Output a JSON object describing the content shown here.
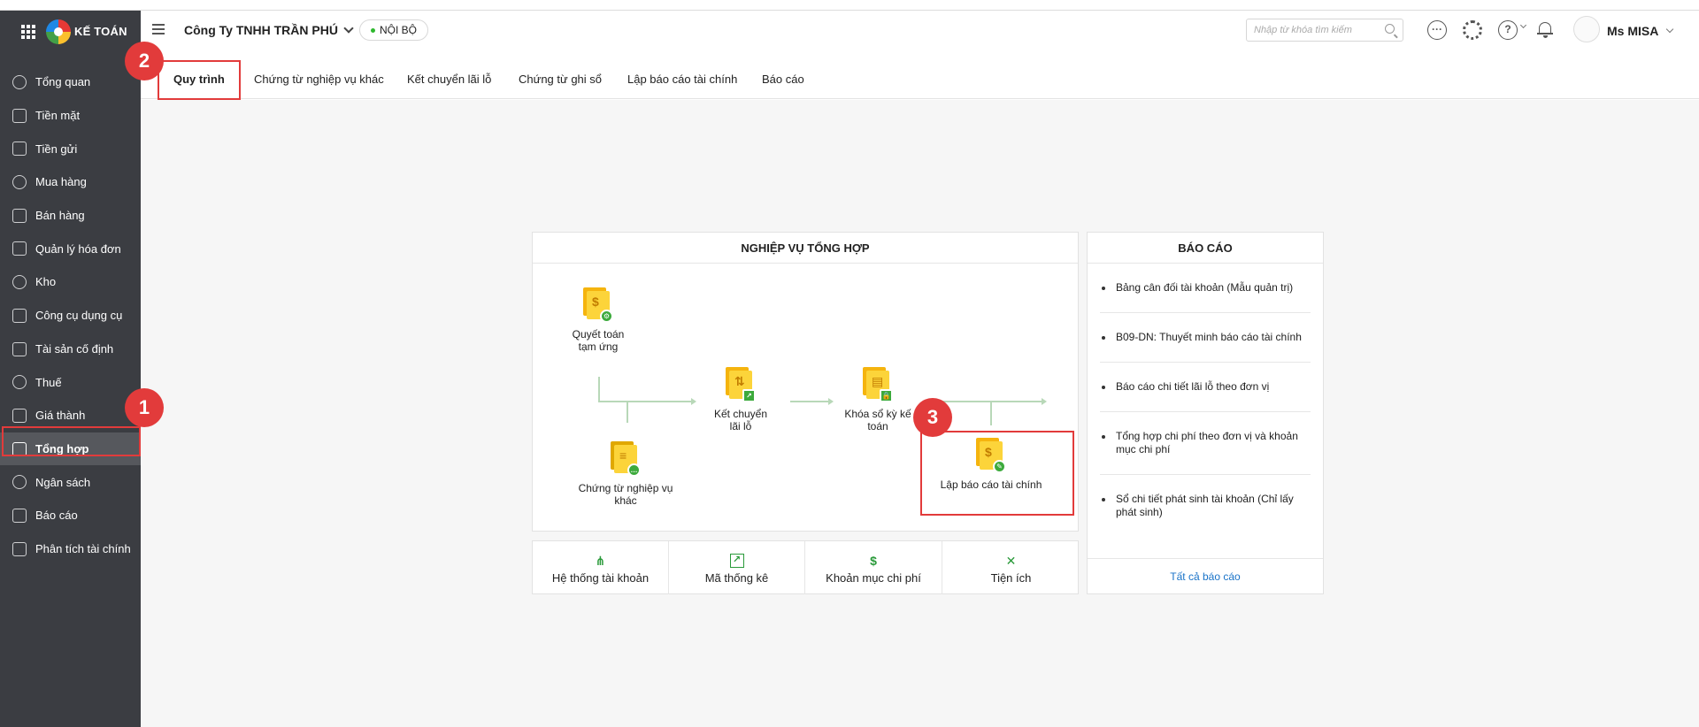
{
  "app": {
    "logo_text": "KẾ TOÁN"
  },
  "header": {
    "company": "Công Ty TNHH TRẦN PHÚ",
    "badge": "NỘI BỘ",
    "search_placeholder": "Nhập từ khóa tìm kiếm",
    "user": "Ms MISA"
  },
  "sidebar": {
    "items": [
      {
        "label": "Tổng quan",
        "icon": "dashboard-icon"
      },
      {
        "label": "Tiền mặt",
        "icon": "cash-icon"
      },
      {
        "label": "Tiền gửi",
        "icon": "bank-icon"
      },
      {
        "label": "Mua hàng",
        "icon": "shopping-bag-icon"
      },
      {
        "label": "Bán hàng",
        "icon": "cart-icon"
      },
      {
        "label": "Quản lý hóa đơn",
        "icon": "invoice-icon"
      },
      {
        "label": "Kho",
        "icon": "warehouse-icon"
      },
      {
        "label": "Công cụ dụng cụ",
        "icon": "tools-icon"
      },
      {
        "label": "Tài sản cố định",
        "icon": "car-icon"
      },
      {
        "label": "Thuế",
        "icon": "tax-icon"
      },
      {
        "label": "Giá thành",
        "icon": "price-tag-icon"
      },
      {
        "label": "Tổng hợp",
        "icon": "summary-icon",
        "active": true
      },
      {
        "label": "Ngân sách",
        "icon": "budget-icon"
      },
      {
        "label": "Báo cáo",
        "icon": "bar-chart-icon"
      },
      {
        "label": "Phân tích tài chính",
        "icon": "line-chart-icon"
      }
    ]
  },
  "tabs": [
    {
      "label": "Quy trình",
      "active": true
    },
    {
      "label": "Chứng từ nghiệp vụ khác"
    },
    {
      "label": "Kết chuyển lãi lỗ"
    },
    {
      "label": "Chứng từ ghi sổ"
    },
    {
      "label": "Lập báo cáo tài chính"
    },
    {
      "label": "Báo cáo"
    }
  ],
  "process": {
    "title": "NGHIỆP VỤ TỔNG HỢP",
    "steps": {
      "advance": "Quyết toán tạm ứng",
      "other": "Chứng từ nghiệp vụ khác",
      "transfer": "Kết chuyển lãi lỗ",
      "lock": "Khóa sổ kỳ kế toán",
      "report": "Lập báo cáo tài chính"
    }
  },
  "utilities": [
    {
      "label": "Hệ thống tài khoản",
      "icon": "account-tree-icon"
    },
    {
      "label": "Mã thống kê",
      "icon": "statistics-icon"
    },
    {
      "label": "Khoản mục chi phí",
      "icon": "cost-item-icon"
    },
    {
      "label": "Tiện ích",
      "icon": "utility-tools-icon"
    }
  ],
  "reports": {
    "title": "BÁO CÁO",
    "items": [
      "Bảng cân đối tài khoản (Mẫu quản trị)",
      "B09-DN: Thuyết minh báo cáo tài chính",
      "Báo cáo chi tiết lãi lỗ theo đơn vị",
      "Tổng hợp chi phí theo đơn vị và khoản mục chi phí",
      "Sổ chi tiết phát sinh tài khoản (Chỉ lấy phát sinh)"
    ],
    "all_link": "Tất cả báo cáo"
  },
  "annotations": [
    "1",
    "2",
    "3"
  ],
  "colors": {
    "sidebar_bg": "#3b3d42",
    "highlight": "#e23b3b",
    "accent_green": "#3caa3c",
    "link": "#1a73c8"
  }
}
